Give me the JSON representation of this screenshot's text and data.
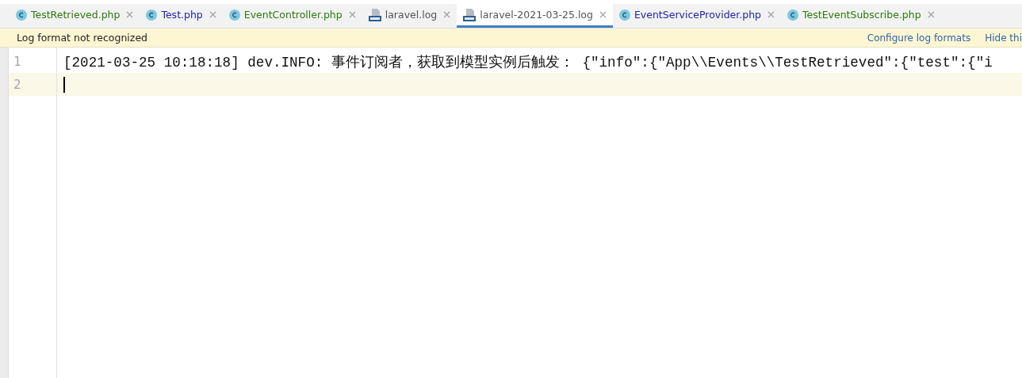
{
  "tabs": [
    {
      "label": "TestRetrieved.php",
      "kind": "php",
      "color": "#2b7a0b",
      "selected": false
    },
    {
      "label": "Test.php",
      "kind": "php",
      "color": "#2222aa",
      "selected": false
    },
    {
      "label": "EventController.php",
      "kind": "php",
      "color": "#2b7a0b",
      "selected": false
    },
    {
      "label": "laravel.log",
      "kind": "log",
      "color": "#555555",
      "selected": false
    },
    {
      "label": "laravel-2021-03-25.log",
      "kind": "log",
      "color": "#555555",
      "selected": true
    },
    {
      "label": "EventServiceProvider.php",
      "kind": "php",
      "color": "#2222aa",
      "selected": false
    },
    {
      "label": "TestEventSubscribe.php",
      "kind": "php",
      "color": "#2b7a0b",
      "selected": false
    }
  ],
  "notification": {
    "message": "Log format not recognized",
    "links": [
      "Configure log formats",
      "Hide thi"
    ]
  },
  "editor": {
    "lines": [
      {
        "number": "1",
        "text": "[2021-03-25 10:18:18] dev.INFO: 事件订阅者，获取到模型实例后触发：  {\"info\":{\"App\\\\Events\\\\TestRetrieved\":{\"test\":{\"i",
        "current": false
      },
      {
        "number": "2",
        "current": true
      }
    ]
  }
}
